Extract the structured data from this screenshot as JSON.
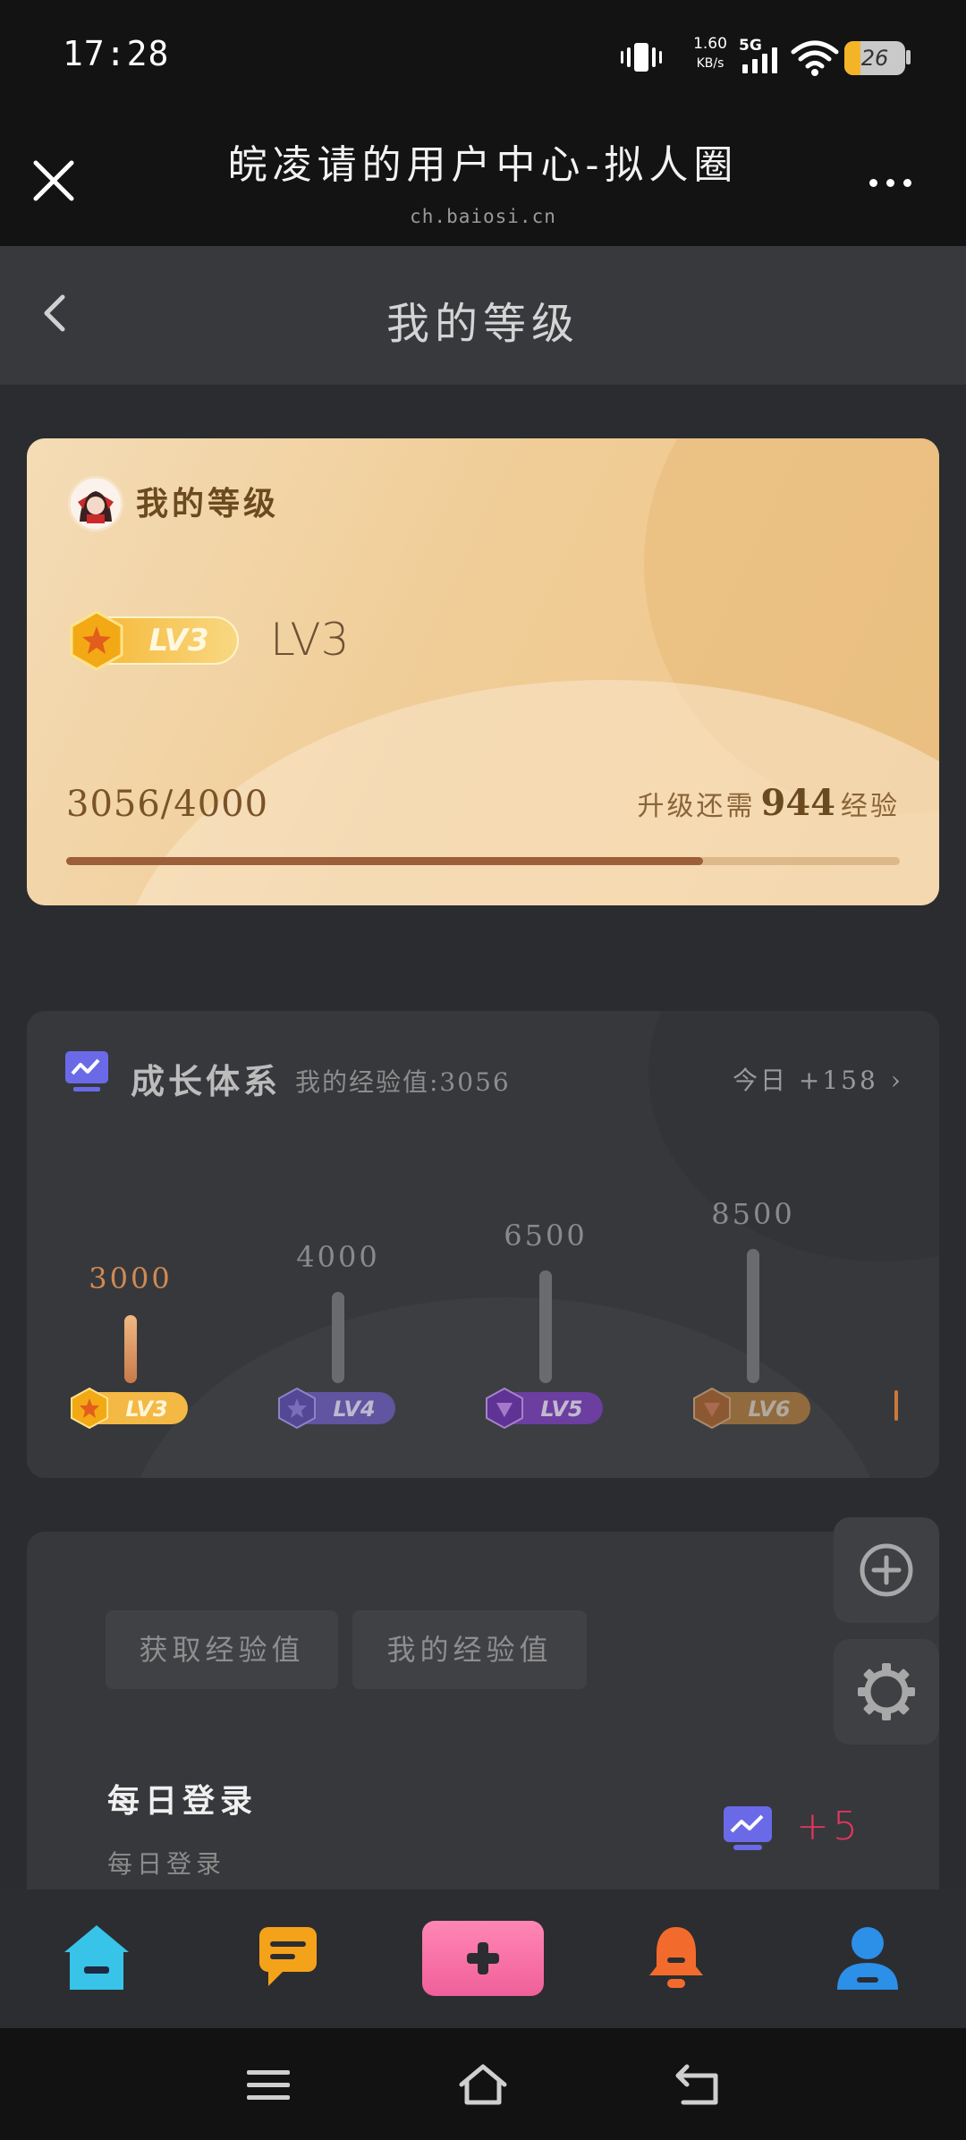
{
  "status_bar": {
    "time": "17:28",
    "net_speed": "1.60",
    "net_speed_unit": "KB/s",
    "network": "5G",
    "battery": "26",
    "battery_level_percent": 26,
    "icons": [
      "vibrate-icon",
      "signal-icon",
      "wifi-icon",
      "battery-icon"
    ]
  },
  "browser": {
    "title": "皖凌请的用户中心-拟人圈",
    "domain": "ch.baiosi.cn",
    "close_icon": "close-icon",
    "more_icon": "more-dots-icon"
  },
  "nav": {
    "title": "我的等级",
    "back_icon": "chevron-left-icon"
  },
  "level_card": {
    "title": "我的等级",
    "badge_label": "LV3",
    "level_text": "LV3",
    "exp_progress": "3056/4000",
    "need_prefix": "升级还需",
    "need_value": "944",
    "need_suffix": "经验",
    "progress_fraction": 0.764,
    "colors": {
      "progress": "#9c5f3a",
      "track": "#ddb98a"
    }
  },
  "growth": {
    "title": "成长体系",
    "my_exp": "我的经验值:3056",
    "today": "今日 +158",
    "levels": [
      {
        "label": "LV3",
        "threshold": "3000",
        "current": true,
        "color": "#e8a040"
      },
      {
        "label": "LV4",
        "threshold": "4000",
        "current": false,
        "color": "#7b62c9"
      },
      {
        "label": "LV5",
        "threshold": "6500",
        "current": false,
        "color": "#8a44c8"
      },
      {
        "label": "LV6",
        "threshold": "8500",
        "current": false,
        "color": "#d98a3c"
      }
    ]
  },
  "tasks": {
    "tabs": [
      "获取经验值",
      "我的经验值"
    ],
    "items": [
      {
        "title": "每日登录",
        "desc": "每日登录",
        "reward": "+5"
      }
    ]
  },
  "floating": [
    "add-circle-icon",
    "settings-gear-icon"
  ],
  "tabbar": {
    "items": [
      "home-icon",
      "message-icon",
      "add-icon",
      "notification-bell-icon",
      "user-profile-icon"
    ]
  },
  "system_nav": [
    "menu-icon",
    "home-outline-icon",
    "back-icon"
  ]
}
